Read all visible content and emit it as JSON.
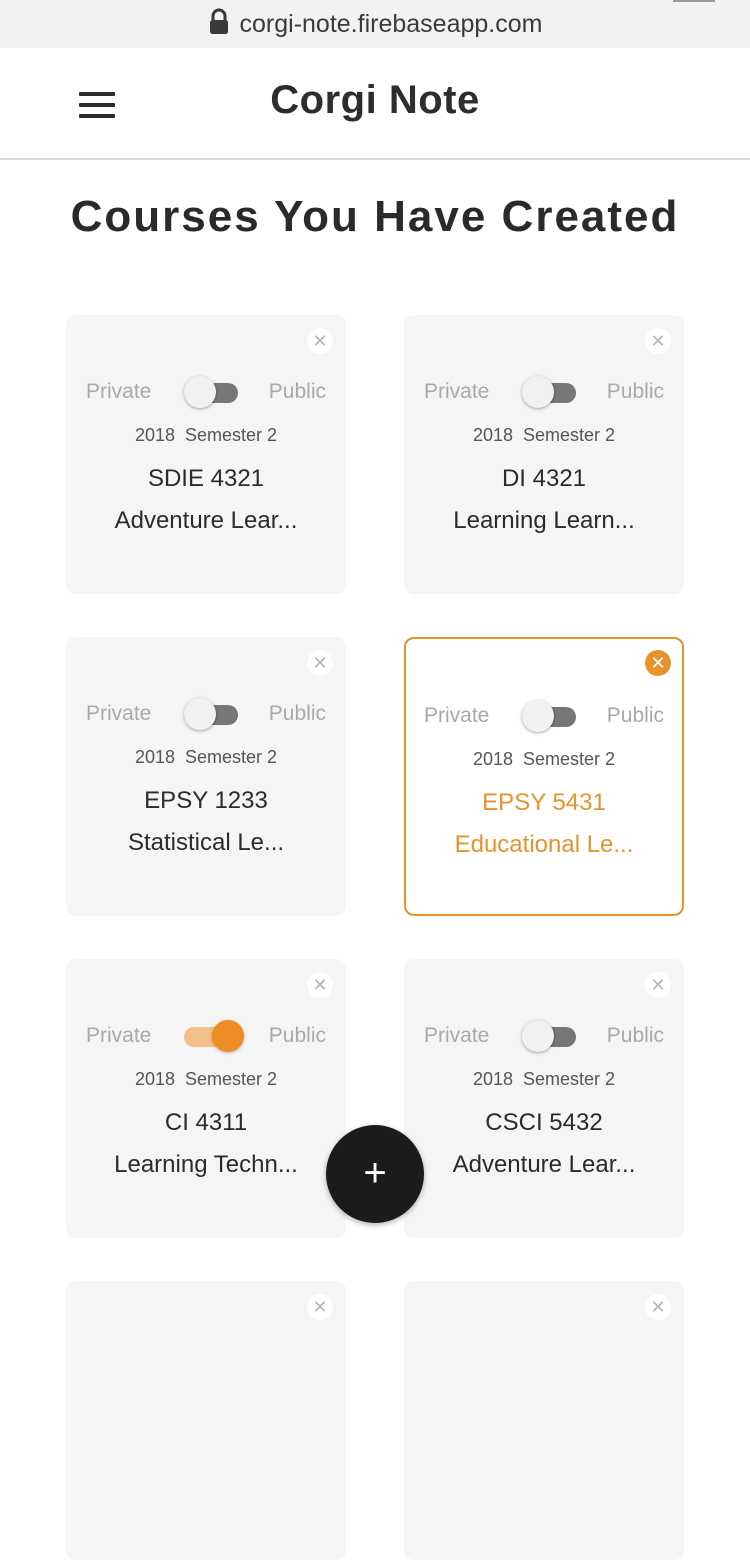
{
  "browser": {
    "url": "corgi-note.firebaseapp.com"
  },
  "header": {
    "title": "Corgi Note"
  },
  "page": {
    "title": "Courses You Have Created"
  },
  "colors": {
    "accent": "#e8922b",
    "card_bg": "#f5f5f5",
    "fab_bg": "#1b1b1b"
  },
  "courses": [
    {
      "private_label": "Private",
      "public_label": "Public",
      "year": "2018",
      "semester": "Semester 2",
      "code": "SDIE 4321",
      "name": "Adventure Lear...",
      "public": false,
      "selected": false
    },
    {
      "private_label": "Private",
      "public_label": "Public",
      "year": "2018",
      "semester": "Semester 2",
      "code": "DI 4321",
      "name": "Learning Learn...",
      "public": false,
      "selected": false
    },
    {
      "private_label": "Private",
      "public_label": "Public",
      "year": "2018",
      "semester": "Semester 2",
      "code": "EPSY 1233",
      "name": "Statistical Le...",
      "public": false,
      "selected": false
    },
    {
      "private_label": "Private",
      "public_label": "Public",
      "year": "2018",
      "semester": "Semester 2",
      "code": "EPSY 5431",
      "name": "Educational Le...",
      "public": false,
      "selected": true
    },
    {
      "private_label": "Private",
      "public_label": "Public",
      "year": "2018",
      "semester": "Semester 2",
      "code": "CI 4311",
      "name": "Learning Techn...",
      "public": true,
      "selected": false
    },
    {
      "private_label": "Private",
      "public_label": "Public",
      "year": "2018",
      "semester": "Semester 2",
      "code": "CSCI 5432",
      "name": "Adventure Lear...",
      "public": false,
      "selected": false
    },
    {
      "private_label": "",
      "public_label": "",
      "year": "",
      "semester": "",
      "code": "",
      "name": "",
      "public": false,
      "selected": false
    },
    {
      "private_label": "",
      "public_label": "",
      "year": "",
      "semester": "",
      "code": "",
      "name": "",
      "public": false,
      "selected": false
    }
  ],
  "icons": {
    "menu": "hamburger-menu-icon",
    "lock": "lock-icon",
    "close": "close-icon",
    "add": "plus-icon"
  },
  "fab": {
    "label": "+"
  },
  "close_glyph": "✕"
}
